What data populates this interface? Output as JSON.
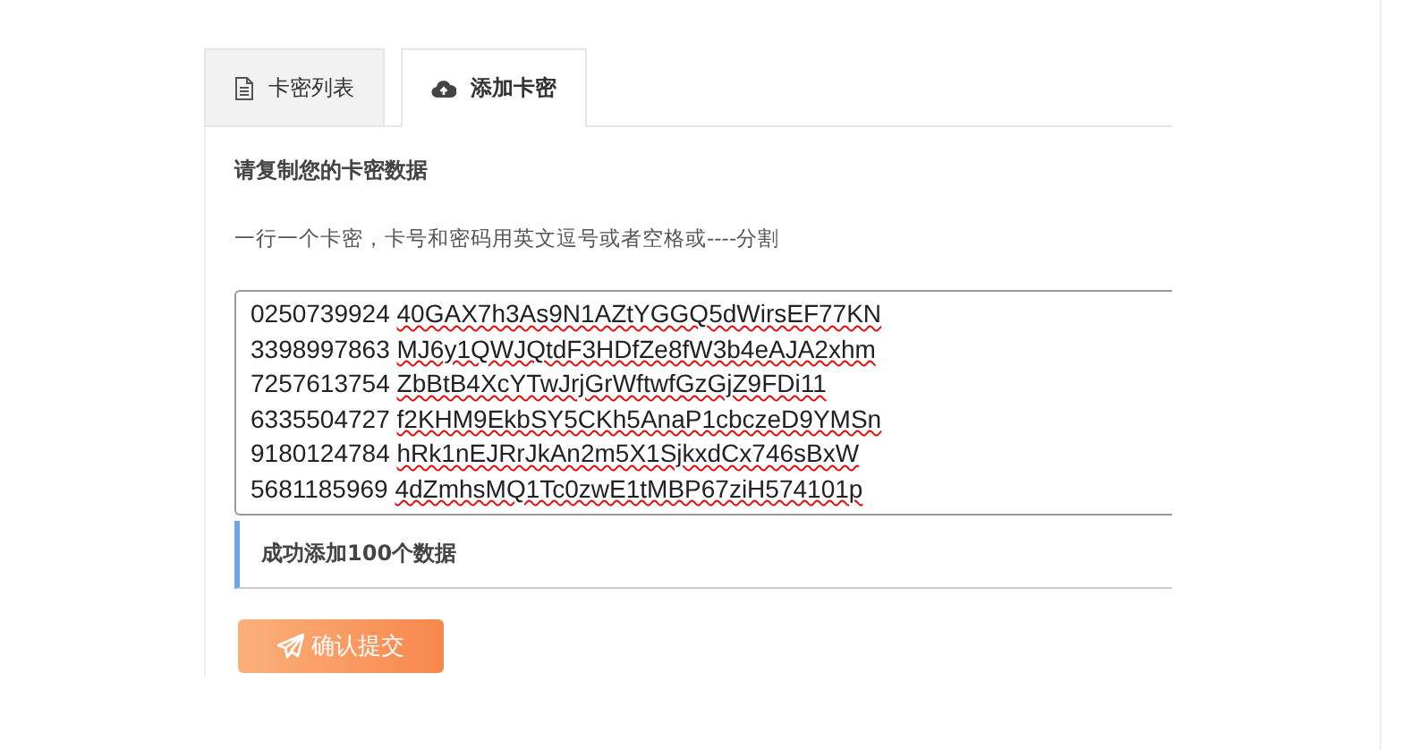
{
  "tabs": [
    {
      "label": "卡密列表",
      "kind": "list",
      "selected": false
    },
    {
      "label": "添加卡密",
      "kind": "add",
      "selected": true
    }
  ],
  "heading": "请复制您的卡密数据",
  "hint": "一行一个卡密，卡号和密码用英文逗号或者空格或----分割",
  "card_data": {
    "lines": [
      {
        "number": "0250739924",
        "password": "40GAX7h3As9N1AZtYGGQ5dWirsEF77KN"
      },
      {
        "number": "3398997863",
        "password": "MJ6y1QWJQtdF3HDfZe8fW3b4eAJA2xhm"
      },
      {
        "number": "7257613754",
        "password": "ZbBtB4XcYTwJrjGrWftwfGzGjZ9FDi11"
      },
      {
        "number": "6335504727",
        "password": "f2KHM9EkbSY5CKh5AnaP1cbczeD9YMSn"
      },
      {
        "number": "9180124784",
        "password": "hRk1nEJRrJkAn2m5X1SjkxdCx746sBxW"
      },
      {
        "number": "5681185969",
        "password": "4dZmhsMQ1Tc0zwE1tMBP67ziH574101p"
      }
    ]
  },
  "alert": "成功添加100个数据",
  "submit_button": "确认提交"
}
